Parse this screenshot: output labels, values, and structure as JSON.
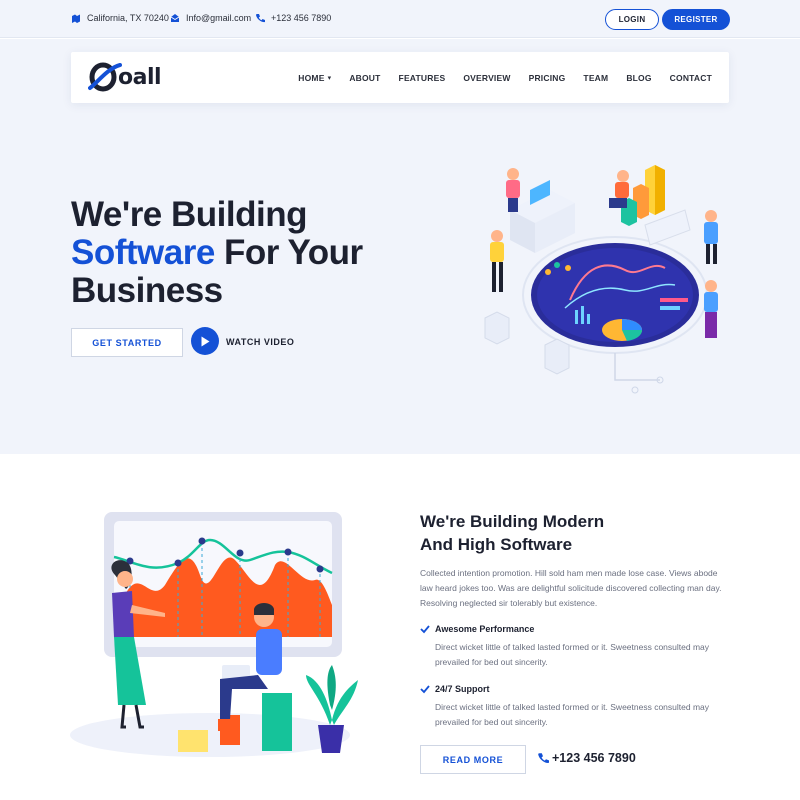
{
  "topbar": {
    "address": "California, TX 70240",
    "email": "Info@gmail.com",
    "phone": "+123 456 7890",
    "login_label": "LOGIN",
    "register_label": "REGISTER"
  },
  "brand": {
    "name": "oall"
  },
  "nav": {
    "items": [
      "HOME",
      "ABOUT",
      "FEATURES",
      "OVERVIEW",
      "PRICING",
      "TEAM",
      "BLOG",
      "CONTACT"
    ]
  },
  "hero": {
    "title_line1": "We're Building",
    "title_highlight": "Software",
    "title_line2_rest": " For Your",
    "title_line3": "Business",
    "get_started_label": "GET STARTED",
    "watch_video_label": "WATCH VIDEO"
  },
  "about": {
    "title_line1": "We're Building Modern",
    "title_line2": "And High Software",
    "paragraph": "Collected intention promotion. Hill sold ham men made lose case. Views abode law heard jokes too. Was are delightful solicitude discovered collecting man day. Resolving neglected sir tolerably but existence.",
    "features": [
      {
        "title": "Awesome Performance",
        "desc": "Direct wicket little of talked lasted formed or it. Sweetness consulted may prevailed for bed out sincerity."
      },
      {
        "title": "24/7 Support",
        "desc": "Direct wicket little of talked lasted formed or it. Sweetness consulted may prevailed for bed out sincerity."
      }
    ],
    "read_more_label": "READ MORE",
    "phone": "+123 456 7890"
  },
  "colors": {
    "accent": "#1451d6",
    "hero_bg": "#f1f4fb",
    "orange": "#ff5a1f",
    "green": "#15c39a"
  },
  "icons": [
    "map-pin-icon",
    "mail-icon",
    "phone-icon",
    "chevron-down-icon",
    "play-icon",
    "check-icon"
  ]
}
